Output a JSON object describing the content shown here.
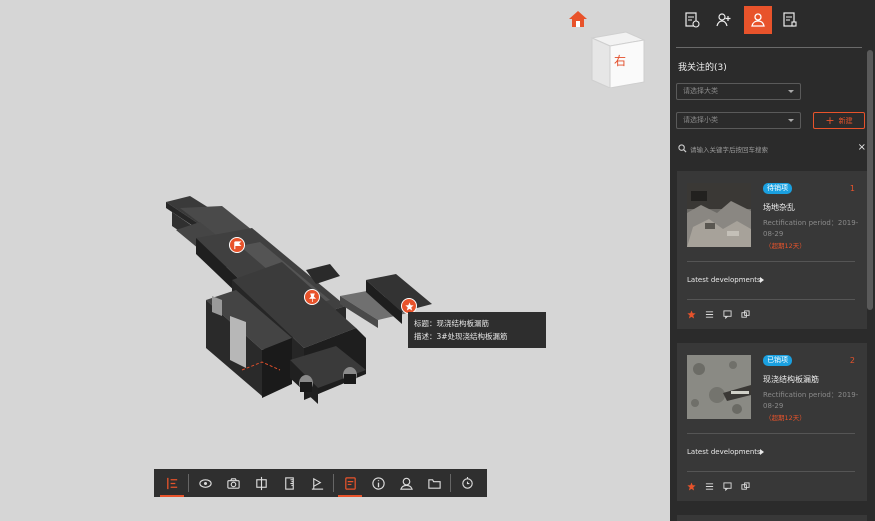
{
  "viewport": {
    "view_cube_label": "右",
    "tooltip": {
      "title_line": "标题：现浇结构板漏筋",
      "desc_line": "描述：3#处现浇结构板漏筋"
    }
  },
  "toolbar": {
    "items": [
      {
        "name": "list-icon",
        "active": true
      },
      {
        "name": "eye-icon",
        "active": false
      },
      {
        "name": "camera-icon",
        "active": false
      },
      {
        "name": "section-icon",
        "active": false
      },
      {
        "name": "measure-icon",
        "active": false
      },
      {
        "name": "flag-icon",
        "active": false
      },
      {
        "name": "issue-icon",
        "active": true
      },
      {
        "name": "info-icon",
        "active": false
      },
      {
        "name": "location-icon",
        "active": false
      },
      {
        "name": "folder-icon",
        "active": false
      },
      {
        "name": "settings-icon",
        "active": false
      }
    ]
  },
  "panel": {
    "tabs": [
      {
        "name": "document-clock-icon",
        "active": false
      },
      {
        "name": "add-user-icon",
        "active": false
      },
      {
        "name": "follow-user-icon",
        "active": true
      },
      {
        "name": "document-grid-icon",
        "active": false
      }
    ],
    "heading": "我关注的(3)",
    "select_major_placeholder": "请选择大类",
    "select_minor_placeholder": "请选择小类",
    "new_button_label": "新建",
    "search_placeholder": "请输入关键字后按回车搜索",
    "cards": [
      {
        "status": "待销项",
        "status_color": "#1aa0e0",
        "index": "1",
        "title": "场地杂乱",
        "period": "Rectification period：2019-08-29",
        "overdue": "（超期12天）",
        "latest_label": "Latest developments"
      },
      {
        "status": "已销项",
        "status_color": "#1aa0e0",
        "index": "2",
        "title": "现浇结构板漏筋",
        "period": "Rectification period：2019-08-29",
        "overdue": "（超期12天）",
        "latest_label": "Latest developments"
      }
    ]
  },
  "colors": {
    "accent": "#e8532b",
    "panel_bg": "#2b2b2b",
    "card_bg": "#383838",
    "viewport_bg": "#d6d6d6",
    "badge": "#1aa0e0"
  }
}
